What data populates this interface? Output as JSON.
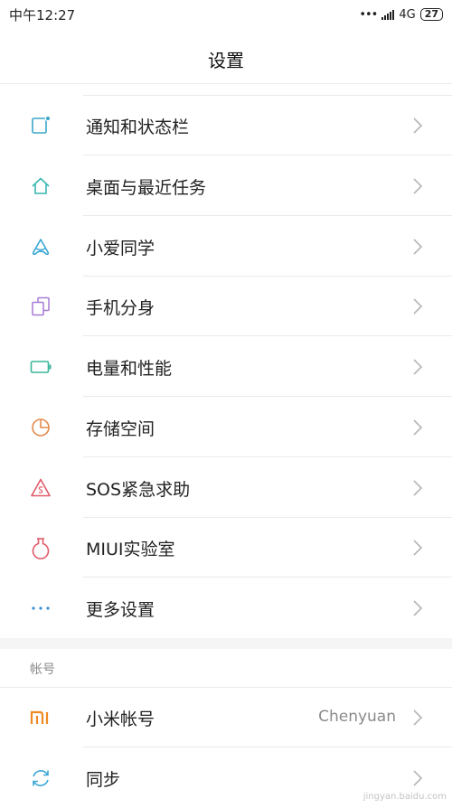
{
  "status_bar": {
    "time": "中午12:27",
    "dots": "•••",
    "network": "4G",
    "battery": "27"
  },
  "header": {
    "title": "设置"
  },
  "items": [
    {
      "label": "通知和状态栏",
      "icon": "notification-icon",
      "color": "#3aa7c9"
    },
    {
      "label": "桌面与最近任务",
      "icon": "home-icon",
      "color": "#39b6b0"
    },
    {
      "label": "小爱同学",
      "icon": "xiaoai-icon",
      "color": "#3aa7d6"
    },
    {
      "label": "手机分身",
      "icon": "second-space-icon",
      "color": "#a77ad6"
    },
    {
      "label": "电量和性能",
      "icon": "battery-icon",
      "color": "#38b69a"
    },
    {
      "label": "存储空间",
      "icon": "storage-icon",
      "color": "#e48b4c"
    },
    {
      "label": "SOS紧急求助",
      "icon": "sos-icon",
      "color": "#e05b6a"
    },
    {
      "label": "MIUI实验室",
      "icon": "lab-flask-icon",
      "color": "#e05b6a"
    },
    {
      "label": "更多设置",
      "icon": "more-dots-icon",
      "color": "#3a8fd6"
    }
  ],
  "account_section": {
    "title": "帐号",
    "items": [
      {
        "label": "小米帐号",
        "value": "Chenyuan",
        "icon": "mi-logo-icon",
        "color": "#f08a24"
      },
      {
        "label": "同步",
        "icon": "sync-icon",
        "color": "#3aa7d6"
      }
    ]
  },
  "watermark": "jingyan.baidu.com"
}
